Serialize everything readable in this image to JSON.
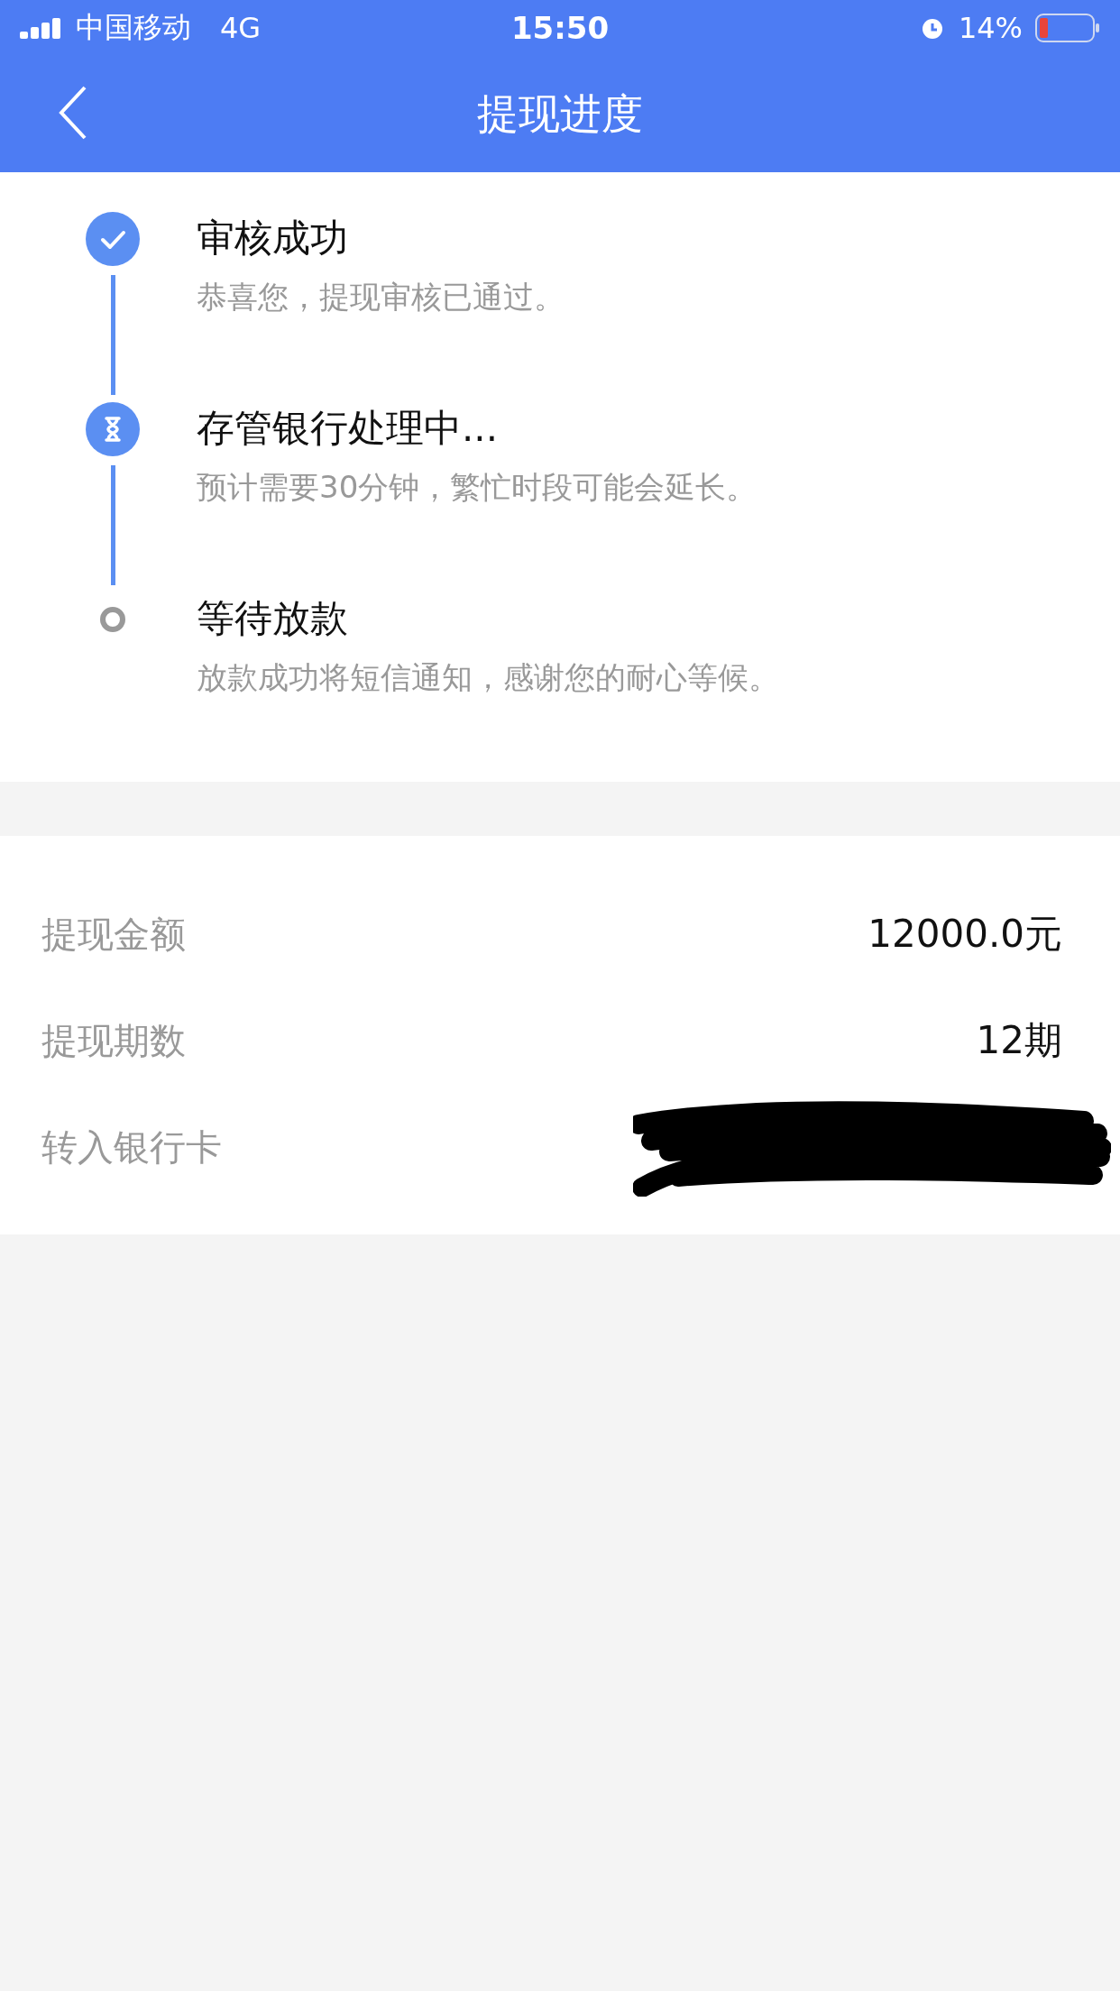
{
  "status_bar": {
    "carrier": "中国移动",
    "network": "4G",
    "time": "15:50",
    "battery": "14%"
  },
  "nav": {
    "title": "提现进度"
  },
  "steps": [
    {
      "kind": "done",
      "title": "审核成功",
      "description": "恭喜您，提现审核已通过。"
    },
    {
      "kind": "active",
      "title": "存管银行处理中...",
      "description": "预计需要30分钟，繁忙时段可能会延长。"
    },
    {
      "kind": "pending",
      "title": "等待放款",
      "description": "放款成功将短信通知，感谢您的耐心等候。"
    }
  ],
  "details": [
    {
      "kind": "text",
      "label": "提现金额",
      "value": "12000.0元"
    },
    {
      "kind": "text",
      "label": "提现期数",
      "value": "12期"
    },
    {
      "kind": "redacted",
      "label": "转入银行卡"
    }
  ]
}
